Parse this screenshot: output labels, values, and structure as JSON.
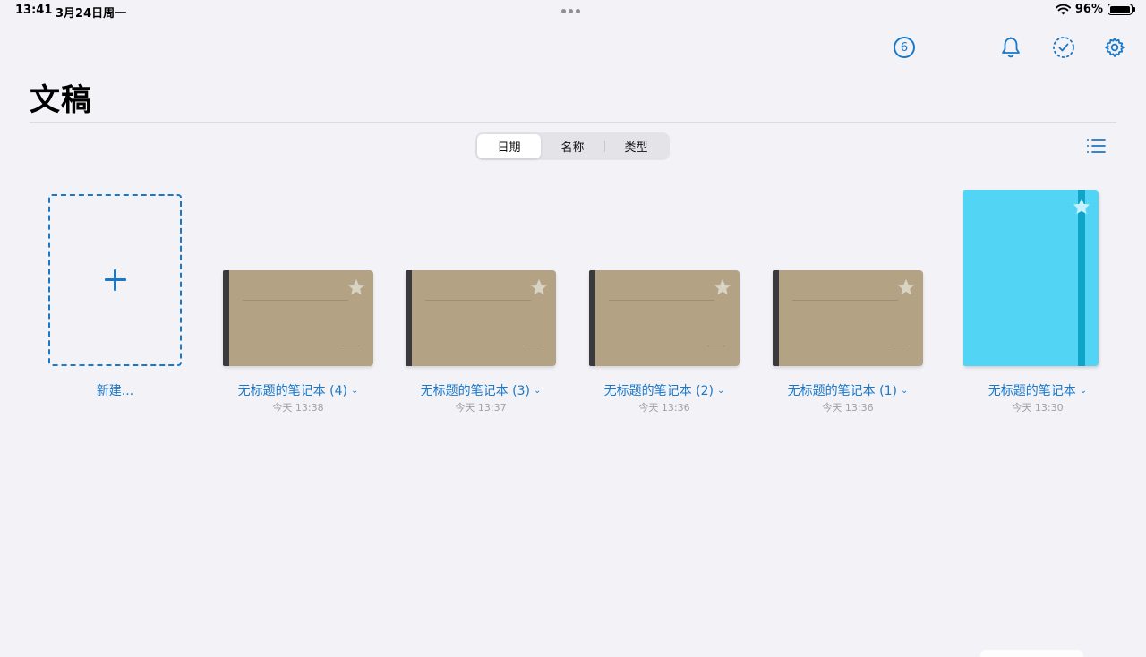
{
  "status": {
    "time": "13:41",
    "date": "3月24日周一",
    "battery": "96%",
    "battery_level": 0.96
  },
  "toolbar": {
    "badge_count": "6",
    "icons": [
      "badge-6-icon",
      "bell-icon",
      "check-circle-icon",
      "gear-icon"
    ]
  },
  "page": {
    "title": "文稿"
  },
  "sort": {
    "options": [
      "日期",
      "名称",
      "类型"
    ],
    "selected": "日期"
  },
  "new_item": {
    "label": "新建..."
  },
  "documents": [
    {
      "name": "无标题的笔记本 (4)",
      "date": "今天 13:38",
      "cover": "kraft"
    },
    {
      "name": "无标题的笔记本 (3)",
      "date": "今天 13:37",
      "cover": "kraft"
    },
    {
      "name": "无标题的笔记本 (2)",
      "date": "今天 13:36",
      "cover": "kraft"
    },
    {
      "name": "无标题的笔记本 (1)",
      "date": "今天 13:36",
      "cover": "kraft"
    },
    {
      "name": "无标题的笔记本",
      "date": "今天 13:30",
      "cover": "cyan"
    }
  ],
  "colors": {
    "accent": "#1a78c9",
    "background": "#f2f2f7",
    "kraft": "#b3a284",
    "cyan": "#52d5f5"
  }
}
